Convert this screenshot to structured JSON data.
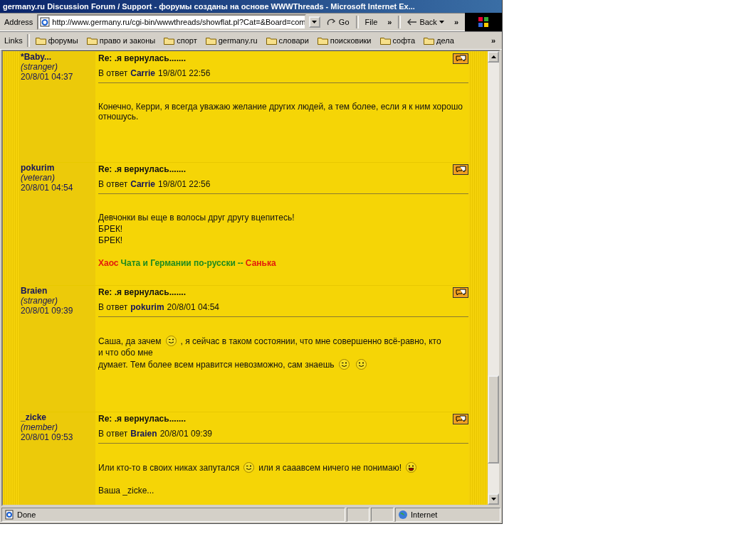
{
  "window": {
    "title": "germany.ru Discussion Forum / Support - форумы созданы на основе WWWThreads - Microsoft Internet Ex..."
  },
  "address_bar": {
    "label": "Address",
    "value": "http://www.germany.ru/cgi-bin/wwwthreads/showflat.pl?Cat=&Board=com",
    "go": "Go",
    "menu": "File",
    "more": "»",
    "back": "Back",
    "more_right": "»"
  },
  "links_bar": {
    "label": "Links",
    "items": [
      "форумы",
      "право и законы",
      "спорт",
      "germany.ru",
      "словари",
      "поисковики",
      "софта",
      "дела"
    ],
    "more": "»"
  },
  "posts": [
    {
      "author": "*Baby...",
      "rank": "(stranger)",
      "date": "20/8/01 04:37",
      "subject": "Re: .я вернулась.......",
      "reply_prefix": "В ответ",
      "reply_to": "Carrie",
      "reply_date": "19/8/01 22:56",
      "body": [
        {
          "kind": "line",
          "parts": [
            {
              "kind": "text",
              "text": "Конечно, Керри, я всегда уважаю желание других людей, а тем более, если я к ним хорошо отношусь."
            }
          ]
        }
      ]
    },
    {
      "author": "pokurim",
      "rank": "(veteran)",
      "date": "20/8/01 04:54",
      "subject": "Re: .я вернулась.......",
      "reply_prefix": "В ответ",
      "reply_to": "Carrie",
      "reply_date": "19/8/01 22:56",
      "body": [
        {
          "kind": "line",
          "parts": [
            {
              "kind": "text",
              "text": "Девчонки вы еще в волосы друг другу вцепитесь!"
            }
          ]
        },
        {
          "kind": "line",
          "parts": [
            {
              "kind": "text",
              "text": "БРЕК!"
            }
          ]
        },
        {
          "kind": "line",
          "parts": [
            {
              "kind": "text",
              "text": "БРЕК!"
            }
          ]
        },
        {
          "kind": "gap"
        },
        {
          "kind": "signature",
          "parts": [
            {
              "kind": "text",
              "text": "Хаос",
              "color": "#e31b0c"
            },
            {
              "kind": "text",
              "text": "Чата и Германии по-русски",
              "color": "#1f8a1f"
            },
            {
              "kind": "text",
              "text": "--",
              "color": "#1f8a1f"
            },
            {
              "kind": "text",
              "text": "Санька",
              "color": "#e31b0c"
            }
          ]
        }
      ]
    },
    {
      "author": "Braien",
      "rank": "(stranger)",
      "date": "20/8/01 09:39",
      "subject": "Re: .я вернулась.......",
      "reply_prefix": "В ответ",
      "reply_to": "pokurim",
      "reply_date": "20/8/01 04:54",
      "body": [
        {
          "kind": "line",
          "parts": [
            {
              "kind": "text",
              "text": "Саша, да зачем"
            },
            {
              "kind": "wink"
            },
            {
              "kind": "text",
              "text": ", я сейчас в таком состоянии, что мне совершенно всё-равно, кто"
            },
            {
              "kind": "text",
              "text": "и что обо мне"
            }
          ]
        },
        {
          "kind": "line",
          "parts": [
            {
              "kind": "text",
              "text": "думает. Тем более всем нравится невозможно, сам знаешь"
            },
            {
              "kind": "wink"
            },
            {
              "kind": "smile"
            }
          ]
        }
      ]
    },
    {
      "author": "_zicke",
      "rank": "(member)",
      "date": "20/8/01 09:53",
      "subject": "Re: .я вернулась.......",
      "reply_prefix": "В ответ",
      "reply_to": "Braien",
      "reply_date": "20/8/01 09:39",
      "body": [
        {
          "kind": "line",
          "parts": [
            {
              "kind": "text",
              "text": "Или кто-то в своих никах запутался"
            },
            {
              "kind": "wink"
            },
            {
              "kind": "text",
              "text": "или я сааавсем ничего не понимаю!"
            },
            {
              "kind": "grin"
            }
          ]
        },
        {
          "kind": "gap"
        },
        {
          "kind": "line",
          "parts": [
            {
              "kind": "text",
              "text": "Ваша _zicke..."
            }
          ]
        }
      ]
    }
  ],
  "status_bar": {
    "text": "Done",
    "zone": "Internet"
  }
}
